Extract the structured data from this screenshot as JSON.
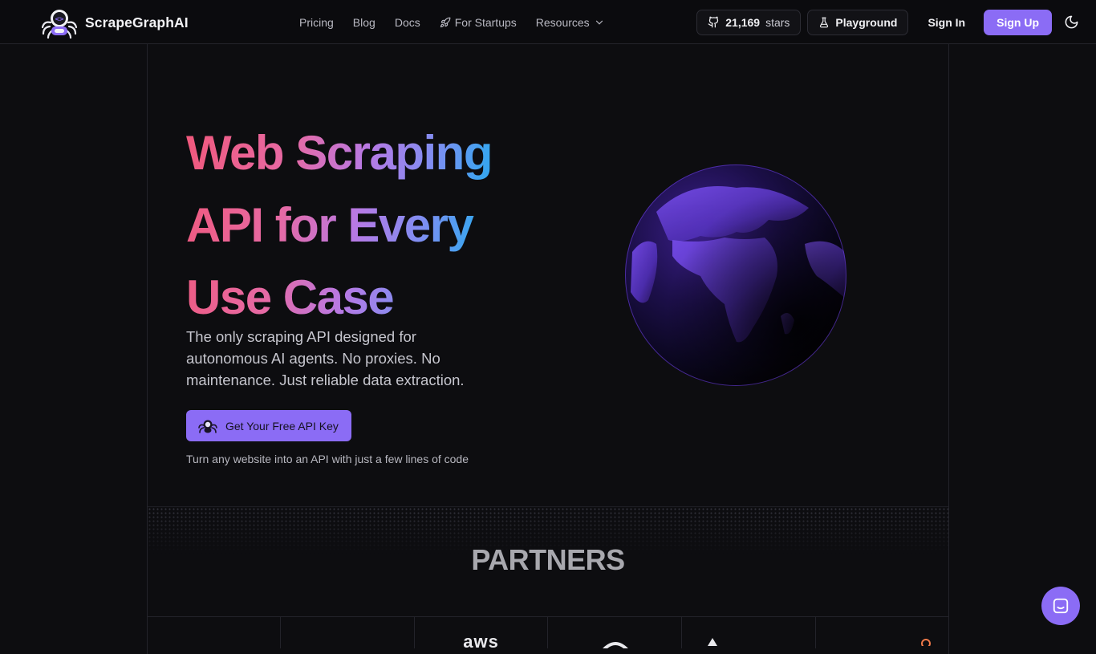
{
  "brand": {
    "name": "ScrapeGraphAI",
    "icon": "spider-robot-logo"
  },
  "nav": {
    "links": [
      {
        "label": "Pricing"
      },
      {
        "label": "Blog"
      },
      {
        "label": "Docs"
      },
      {
        "label": "For Startups",
        "icon": "rocket-icon"
      },
      {
        "label": "Resources",
        "icon": "chevron-down-icon"
      }
    ],
    "github": {
      "count": "21,169",
      "label": "stars",
      "icon": "github-icon"
    },
    "playground": {
      "label": "Playground",
      "icon": "flask-icon"
    },
    "signin": "Sign In",
    "signup": "Sign Up",
    "theme_icon": "moon-icon"
  },
  "hero": {
    "title_lines": [
      "Web Scraping",
      "API for Every",
      "Use Case"
    ],
    "subtitle": "The only scraping API designed for autonomous AI agents. No proxies. No maintenance. Just reliable data extraction.",
    "cta": {
      "label": "Get Your Free API Key",
      "icon": "spider-icon"
    },
    "note": "Turn any website into an API with just a few lines of code"
  },
  "partners": {
    "title": "PARTNERS",
    "logos": [
      "",
      "",
      "aws",
      "",
      "",
      ""
    ]
  },
  "colors": {
    "accent": "#8b6cf5",
    "background": "#0d0d10",
    "gradient": [
      "#f0587b",
      "#b879e4",
      "#3aa5f0",
      "#16a5e9"
    ]
  },
  "chat_icon": "chat-icon"
}
